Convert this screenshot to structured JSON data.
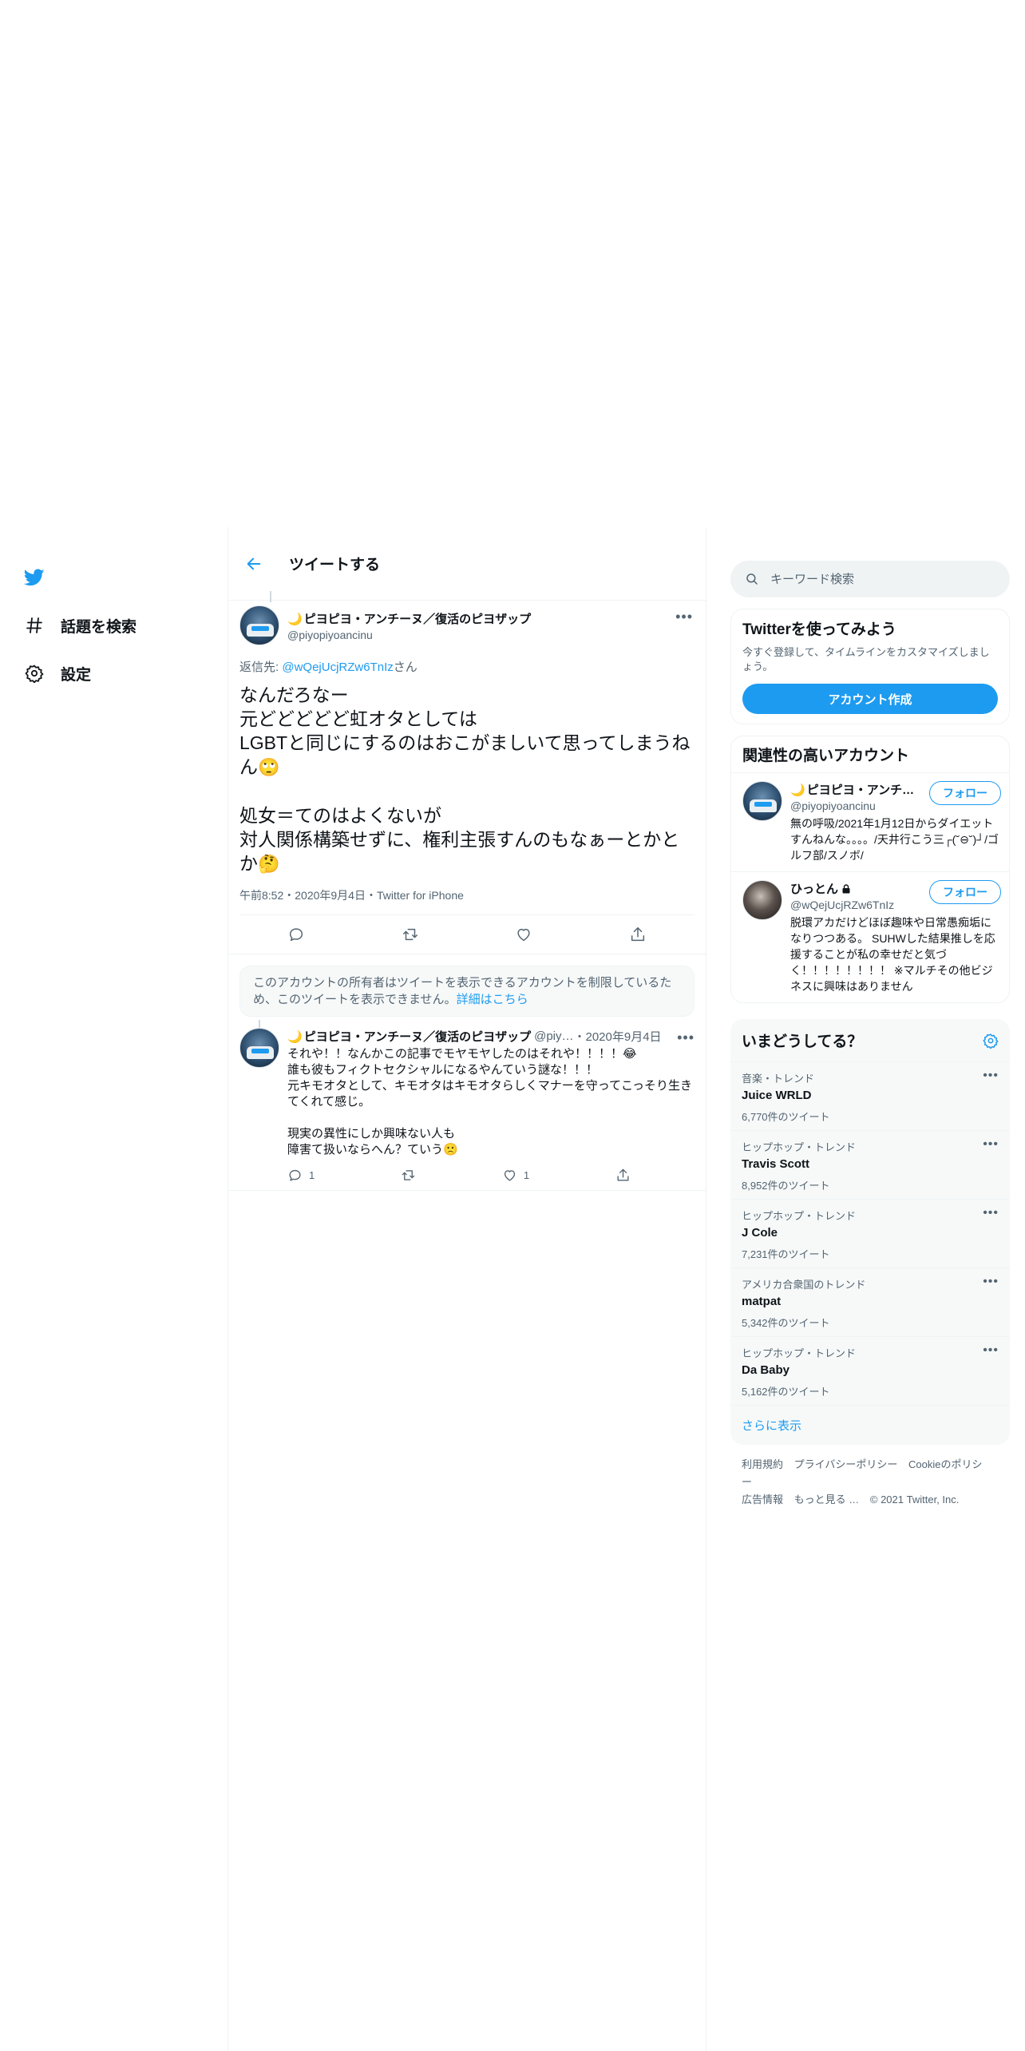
{
  "nav": {
    "items": [
      {
        "label": "話題を検索"
      },
      {
        "label": "設定"
      }
    ]
  },
  "header": {
    "title": "ツイートする"
  },
  "main_tweet": {
    "author_name": "ピヨピヨ・アンチーヌ／復活のピヨザップ",
    "author_handle": "@piyopiyoancinu",
    "reply_prefix": "返信先: ",
    "reply_target": "@wQejUcjRZw6TnIz",
    "reply_suffix": "さん",
    "text_1": "なんだろなー\n元どどどどど虹オタとしては\nLGBTと同じにするのはおこがましいて思ってしまうねん",
    "emoji_1": "🙄",
    "text_2": "\n\n処女＝てのはよくないが\n対人関係構築せずに、権利主張すんのもなぁーとかとか",
    "emoji_2": "🤔",
    "meta": "午前8:52・2020年9月4日・Twitter for iPhone"
  },
  "notice": {
    "text": "このアカウントの所有者はツイートを表示できるアカウントを制限しているため、このツイートを表示できません。",
    "link": "詳細はこちら"
  },
  "reply_tweet": {
    "author_name": "ピヨピヨ・アンチーヌ／復活のピヨザップ",
    "handle_trunc": "@piy…",
    "date": "・2020年9月4日",
    "text_1": "それや！！なんかこの記事でモヤモヤしたのはそれや！！！！",
    "emoji_1": "😂",
    "text_2": "\n誰も彼もフィクトセクシャルになるやんていう謎な！！！\n元キモオタとして、キモオタはキモオタらしくマナーを守ってこっそり生きてくれて感じ。\n\n現実の異性にしか興味ない人も\n障害て扱いならへん？ていう",
    "emoji_2": "🙁",
    "reply_count": "1",
    "like_count": "1"
  },
  "search": {
    "placeholder": "キーワード検索"
  },
  "signup": {
    "title": "Twitterを使ってみよう",
    "desc": "今すぐ登録して、タイムラインをカスタマイズしましょう。",
    "button": "アカウント作成"
  },
  "related": {
    "title": "関連性の高いアカウント",
    "accounts": [
      {
        "name": "ピヨピヨ・アンチ…",
        "handle": "@piyopiyoancinu",
        "follow": "フォロー",
        "bio": "無の呼吸/2021年1月12日からダイエットすんねんな。。。。/天井行こう三┌(˘⊖˘)┘/ゴルフ部/スノボ/"
      },
      {
        "name": "ひっとん",
        "handle": "@wQejUcjRZw6TnIz",
        "follow": "フォロー",
        "bio": "脱環アカだけどほぼ趣味や日常愚痴垢になりつつある。 SUHWした結果推しを応援することが私の幸せだと気づく！！！！！！！！ ※マルチその他ビジネスに興味はありません"
      }
    ]
  },
  "trends": {
    "title": "いまどうしてる？",
    "items": [
      {
        "category": "音楽・トレンド",
        "name": "Juice WRLD",
        "count": "6,770件のツイート"
      },
      {
        "category": "ヒップホップ・トレンド",
        "name": "Travis Scott",
        "count": "8,952件のツイート"
      },
      {
        "category": "ヒップホップ・トレンド",
        "name": "J Cole",
        "count": "7,231件のツイート"
      },
      {
        "category": "アメリカ合衆国のトレンド",
        "name": "matpat",
        "count": "5,342件のツイート"
      },
      {
        "category": "ヒップホップ・トレンド",
        "name": "Da Baby",
        "count": "5,162件のツイート"
      }
    ],
    "show_more": "さらに表示"
  },
  "footer": {
    "links": [
      "利用規約",
      "プライバシーポリシー",
      "Cookieのポリシー",
      "広告情報",
      "もっと見る …",
      "© 2021 Twitter, Inc."
    ]
  },
  "colors": {
    "accent": "#1d9bf0",
    "text": "#0f1419",
    "muted": "#536471"
  }
}
